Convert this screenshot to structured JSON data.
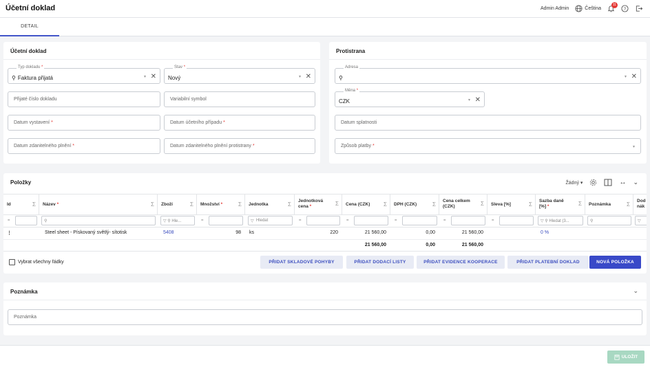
{
  "header": {
    "title": "Účetní doklad",
    "user": "Admin Admin",
    "language": "Čeština",
    "notifications": "11"
  },
  "tabs": {
    "detail": "DETAIL"
  },
  "doc": {
    "title": "Účetní doklad",
    "typ_label": "Typ dokladu",
    "typ_value": "Faktura přijatá",
    "stav_label": "Stav",
    "stav_value": "Nový",
    "prijate": "Přijaté číslo dokladu",
    "varsym": "Variabilní symbol",
    "datum_vyst": "Datum vystavení",
    "datum_ucet": "Datum účetního případu",
    "datum_zdan": "Datum zdanitelného plnění",
    "datum_zdan_proti": "Datum zdanitelného plnění protistrany"
  },
  "proti": {
    "title": "Protistrana",
    "adresa_label": "Adresa",
    "mena_label": "Měna",
    "mena_value": "CZK",
    "datum_splat": "Datum splatnosti",
    "zpusob": "Způsob platby"
  },
  "polozky": {
    "title": "Položky",
    "grouping": "Žádný",
    "columns": {
      "id": "Id",
      "nazev": "Název",
      "zbozi": "Zboží",
      "mnozstvi": "Množství",
      "jednotka": "Jednotka",
      "jedn_cena_1": "Jednotková",
      "jedn_cena_2": "cena",
      "cena": "Cena (CZK)",
      "dph": "DPH (CZK)",
      "celkem_1": "Cena celkem",
      "celkem_2": "(CZK)",
      "sleva": "Sleva [%]",
      "sazba_1": "Sazba daně",
      "sazba_2": "[%]",
      "poznamka": "Poznámka",
      "dod_1": "Dod",
      "dod_2": "nák"
    },
    "filters": {
      "hledat": "Hledat",
      "hledat_3": "Hledat (3..."
    },
    "row": {
      "menu": "⋮",
      "nazev": "Steel sheet - Pískovaný světlý- sítotisk",
      "zbozi": "5408",
      "mnozstvi": "98",
      "jednotka": "ks",
      "jedn_cena": "220",
      "cena": "21 560,00",
      "dph": "0,00",
      "celkem": "21 560,00",
      "sazba": "0 %"
    },
    "totals": {
      "cena": "21 560,00",
      "dph": "0,00",
      "celkem": "21 560,00"
    },
    "select_all": "Vybrat všechny řádky",
    "buttons": {
      "sklad": "PŘIDAT SKLADOVÉ POHYBY",
      "dodaci": "PŘIDAT DODACÍ LISTY",
      "evidence": "PŘIDAT EVIDENCE KOOPERACE",
      "platebni": "PŘIDAT PLATEBNÍ DOKLAD",
      "nova": "NOVÁ POLOŽKA"
    }
  },
  "poznamka": {
    "title": "Poznámka",
    "placeholder": "Poznámka"
  },
  "footer": {
    "save": "ULOŽIT"
  },
  "colors": {
    "accent": "#3949c8",
    "required": "#e53935",
    "save_disabled": "#a8d8c2"
  }
}
